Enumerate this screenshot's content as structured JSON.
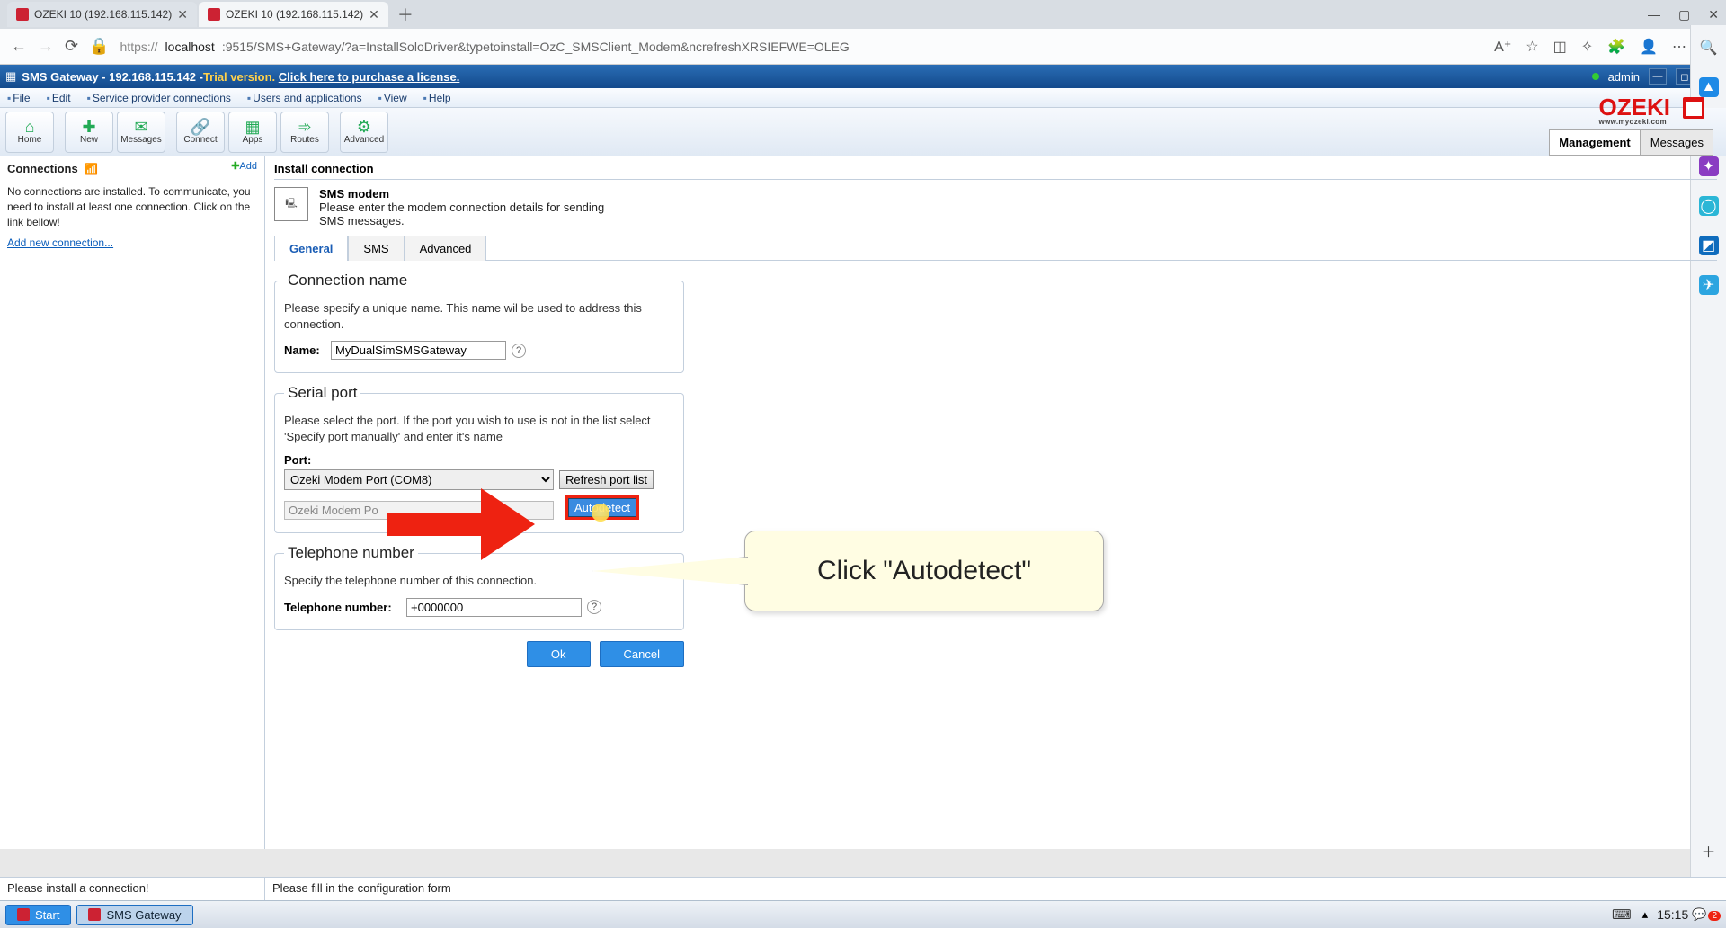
{
  "browser": {
    "tabs": [
      {
        "title": "OZEKI 10 (192.168.115.142)"
      },
      {
        "title": "OZEKI 10 (192.168.115.142)"
      }
    ],
    "url_scheme": "https://",
    "url_host": "localhost",
    "url_rest": ":9515/SMS+Gateway/?a=InstallSoloDriver&typetoinstall=OzC_SMSClient_Modem&ncrefreshXRSIEFWE=OLEG"
  },
  "app_header": {
    "title": "SMS Gateway - 192.168.115.142 - ",
    "trial": "Trial version.",
    "license": "Click here to purchase a license.",
    "user": "admin"
  },
  "menu": [
    "File",
    "Edit",
    "Service provider connections",
    "Users and applications",
    "View",
    "Help"
  ],
  "logo": "OZEKI",
  "logo_sub": "www.myozeki.com",
  "toolbar": [
    {
      "label": "Home",
      "icon": "⌂"
    },
    {
      "label": "New",
      "icon": "✚"
    },
    {
      "label": "Messages",
      "icon": "✉"
    },
    {
      "label": "Connect",
      "icon": "🔗"
    },
    {
      "label": "Apps",
      "icon": "▦"
    },
    {
      "label": "Routes",
      "icon": "➾"
    },
    {
      "label": "Advanced",
      "icon": "⚙"
    }
  ],
  "top_tabs": {
    "management": "Management",
    "messages": "Messages"
  },
  "side": {
    "title": "Connections",
    "add": "Add",
    "text": "No connections are installed. To communicate, you need to install at least one connection. Click on the link bellow!",
    "link": "Add new connection..."
  },
  "content": {
    "title": "Install connection",
    "h": "SMS modem",
    "desc": "Please enter the modem connection details for sending SMS messages.",
    "tabs": [
      "General",
      "SMS",
      "Advanced"
    ],
    "fs1": {
      "legend": "Connection name",
      "hint": "Please specify a unique name. This name wil be used to address this connection.",
      "name_lbl": "Name:",
      "name_val": "MyDualSimSMSGateway"
    },
    "fs2": {
      "legend": "Serial port",
      "hint": "Please select the port. If the port you wish to use is not in the list select 'Specify port manually' and enter it's name",
      "port_lbl": "Port:",
      "port_val": "Ozeki Modem Port (COM8)",
      "refresh": "Refresh port list",
      "autodetect": "Autodetect",
      "disabled": "Ozeki Modem Po"
    },
    "fs3": {
      "legend": "Telephone number",
      "hint": "Specify the telephone number of this connection.",
      "tel_lbl": "Telephone number:",
      "tel_val": "+0000000"
    },
    "ok": "Ok",
    "cancel": "Cancel"
  },
  "callout": "Click \"Autodetect\"",
  "status": {
    "left": "Please install a connection!",
    "right": "Please fill in the configuration form"
  },
  "taskbar": {
    "start": "Start",
    "gw": "SMS Gateway",
    "clock": "15:15",
    "badge": "2"
  }
}
